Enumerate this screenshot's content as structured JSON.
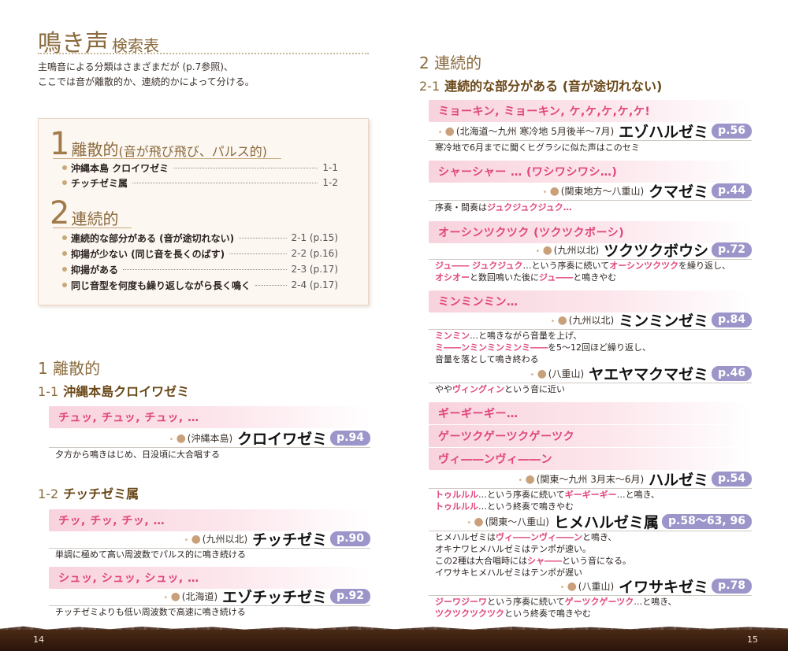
{
  "left": {
    "title_main": "鳴き声",
    "title_sub": "検索表",
    "intro": [
      "主鳴音による分類はさまざまだが (p.7参照)、",
      "ここでは音が離散的か、連続的かによって分ける。"
    ],
    "toc": {
      "g1": {
        "num": "1",
        "name": "離散的",
        "sub": "(音が飛び飛び、パルス的)"
      },
      "g1_items": [
        {
          "label": "沖縄本島 クロイワゼミ",
          "ref": "1-1"
        },
        {
          "label": "チッチゼミ属",
          "ref": "1-2"
        }
      ],
      "g2": {
        "num": "2",
        "name": "連続的"
      },
      "g2_items": [
        {
          "label": "連続的な部分がある (音が途切れない)",
          "ref": "2-1 (p.15)"
        },
        {
          "label": "抑揚が少ない (同じ音を長くのばす)",
          "ref": "2-2 (p.16)"
        },
        {
          "label": "抑揚がある",
          "ref": "2-3 (p.17)"
        },
        {
          "label": "同じ音型を何度も繰り返しながら長く鳴く",
          "ref": "2-4 (p.17)"
        }
      ]
    },
    "sec1": "1 離散的",
    "sub11": {
      "num": "1-1",
      "title": "沖縄本島クロイワゼミ"
    },
    "call11": "チュッ, チュッ, チュッ, …",
    "sp11": {
      "region": "(沖縄本島)",
      "name": "クロイワゼミ",
      "page": "p.94",
      "desc": "夕方から鳴きはじめ、日没頃に大合唱する"
    },
    "sub12": {
      "num": "1-2",
      "title": "チッチゼミ属"
    },
    "call12a": "チッ, チッ, チッ, …",
    "sp12a": {
      "region": "(九州以北)",
      "name": "チッチゼミ",
      "page": "p.90",
      "desc": "単調に極めて高い周波数でパルス的に鳴き続ける"
    },
    "call12b": "シュッ, シュッ, シュッ, …",
    "sp12b": {
      "region": "(北海道)",
      "name": "エゾチッチゼミ",
      "page": "p.92",
      "desc": "チッチゼミよりも低い周波数で高速に鳴き続ける"
    },
    "page_number": "14"
  },
  "right": {
    "sec2": "2 連続的",
    "sub21": {
      "num": "2-1",
      "title": "連続的な部分がある (音が途切れない)"
    },
    "call1": "ミョーキン, ミョーキン, ケ,ケ,ケ,ケ,ケ!",
    "sp1": {
      "region": "(北海道〜九州 寒冷地 5月後半〜7月)",
      "name": "エゾハルゼミ",
      "page": "p.56",
      "desc": "寒冷地で6月までに聞くヒグラシに似た声はこのセミ"
    },
    "call2": "シャーシャー … (ワシワシワシ…)",
    "sp2": {
      "region": "(関東地方〜八重山)",
      "name": "クマゼミ",
      "page": "p.44"
    },
    "sp2_desc": {
      "a": "序奏・間奏は",
      "b": "ジュクジュクジュク…"
    },
    "call3": "オーシンツクツク (ツクツクボーシ)",
    "sp3": {
      "region": "(九州以北)",
      "name": "ツクツクボウシ",
      "page": "p.72"
    },
    "sp3_desc": {
      "l1a": "ジュ―― ジュクジュク",
      "l1b": "…という序奏に続いて",
      "l1c": "オーシンツクツク",
      "l1d": "を繰り返し、",
      "l2a": "オシオー",
      "l2b": "と数回鳴いた後に",
      "l2c": "ジュ――",
      "l2d": "と鳴きやむ"
    },
    "call4": "ミンミンミン…",
    "sp4": {
      "region": "(九州以北)",
      "name": "ミンミンゼミ",
      "page": "p.84"
    },
    "sp4_desc": {
      "l1a": "ミンミン",
      "l1b": "…と鳴きながら音量を上げ、",
      "l2a": "ミ――ンミンミンミンミ――",
      "l2b": "を5〜12回ほど繰り返し、",
      "l3": "音量を落として鳴き終わる"
    },
    "sp5": {
      "region": "(八重山)",
      "name": "ヤエヤマクマゼミ",
      "page": "p.46"
    },
    "sp5_desc": {
      "a": "やや",
      "b": "ヴィングィン",
      "c": "という音に近い"
    },
    "call5": "ギーギーギー…",
    "call6": "ゲーツクゲーツクゲーツク",
    "call7": "ヴィ――ンヴィ――ン",
    "sp6": {
      "region": "(関東〜九州 3月末〜6月)",
      "name": "ハルゼミ",
      "page": "p.54"
    },
    "sp6_desc": {
      "l1a": "トゥルルル",
      "l1b": "…という序奏に続いて",
      "l1c": "ギーギーギー",
      "l1d": "…と鳴き、",
      "l2a": "トゥルルル",
      "l2b": "…という終奏で鳴きやむ"
    },
    "sp7": {
      "region": "(関東〜八重山)",
      "name": "ヒメハルゼミ属",
      "page": "p.58〜63, 96"
    },
    "sp7_desc": {
      "l1a": "ヒメハルゼミは",
      "l1b": "ヴィ――ンヴィ――ン",
      "l1c": "と鳴き、",
      "l2": "オキナワヒメハルゼミはテンポが速い。",
      "l3a": "この2種は大合唱時には",
      "l3b": "シャ――",
      "l3c": "という音になる。",
      "l4": "イワサキヒメハルゼミはテンポが遅い"
    },
    "sp8": {
      "region": "(八重山)",
      "name": "イワサキゼミ",
      "page": "p.78"
    },
    "sp8_desc": {
      "l1a": "ジーワジーワ",
      "l1b": "という序奏に続いて",
      "l1c": "ゲーツクゲーツク",
      "l1d": "…と鳴き、",
      "l2a": "ツクツクツクツク",
      "l2b": "という終奏で鳴きやむ"
    },
    "page_number": "15"
  },
  "colors": {
    "accent_brown": "#8a6b3e",
    "call_pink": "#e0457b",
    "page_badge": "#9b95c9",
    "footer": "#3a1e0e"
  }
}
